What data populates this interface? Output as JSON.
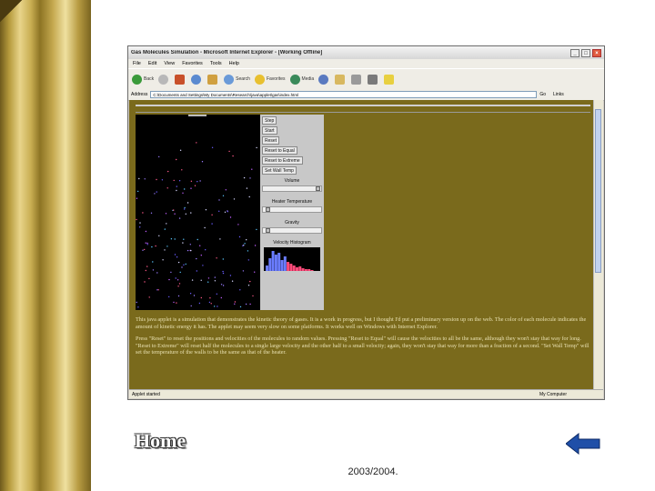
{
  "window": {
    "title": "Gas Molecules Simulation - Microsoft Internet Explorer - [Working Offline]",
    "controls": [
      "_",
      "□",
      "×"
    ]
  },
  "menu": [
    "File",
    "Edit",
    "View",
    "Favorites",
    "Tools",
    "Help"
  ],
  "toolbar": {
    "back": "Back",
    "search": "Search",
    "favorites": "Favorites",
    "media": "Media"
  },
  "address": {
    "label": "Address",
    "value": "C:\\Documents and Settings\\My Documents\\Research\\java\\applet\\gas\\index.html",
    "go": "Go",
    "links": "Links"
  },
  "panel": {
    "buttons": [
      "Step",
      "Start",
      "Reset",
      "Reset to Equal",
      "Reset to Extreme",
      "Set Wall Temp"
    ],
    "volume_label": "Volume",
    "heater_label": "Heater Temperature",
    "gravity_label": "Gravity",
    "histogram_label": "Velocity Histogram"
  },
  "description": {
    "p1": "This java applet is a simulation that demonstrates the kinetic theory of gases. It is a work in progress, but I thought I'd put a preliminary version up on the web. The color of each molecule indicates the amount of kinetic energy it has. The applet may seem very slow on some platforms. It works well on Windows with Internet Explorer.",
    "p2": "Press \"Reset\" to reset the positions and velocities of the molecules to random values. Pressing \"Reset to Equal\" will cause the velocities to all be the same, although they won't stay that way for long. \"Reset to Extreme\" will reset half the molecules to a single large velocity and the other half to a small velocity; again, they won't stay that way for more than a fraction of a second. \"Set Wall Temp\" will set the temperature of the walls to be the same as that of the heater."
  },
  "status": {
    "left": "Applet started",
    "right": "My Computer"
  },
  "slide": {
    "home_label": "Home",
    "footer": "2003/2004."
  },
  "colors": {
    "gold_light": "#efe0a0",
    "gold_dark": "#6e5a1c",
    "content_bg": "#7a6a1c",
    "arrow_blue": "#1f4fa8"
  }
}
